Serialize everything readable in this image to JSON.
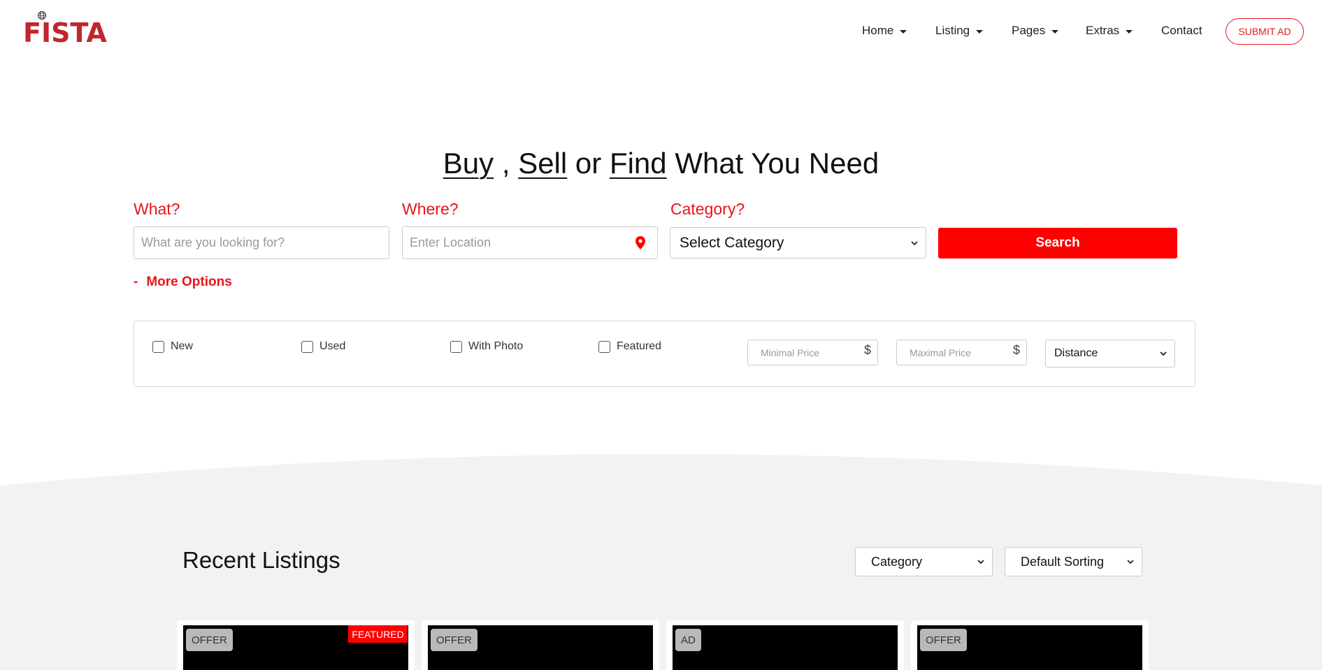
{
  "brand": {
    "logo_text": "FISTA",
    "color": "#c0262d",
    "accent": "#e8151b"
  },
  "nav": {
    "items": [
      {
        "label": "Home",
        "dropdown": true
      },
      {
        "label": "Listing",
        "dropdown": true
      },
      {
        "label": "Pages",
        "dropdown": true
      },
      {
        "label": "Extras",
        "dropdown": true
      },
      {
        "label": "Contact",
        "dropdown": false
      }
    ],
    "submit_label": "SUBMIT AD"
  },
  "hero": {
    "word1": "Buy",
    "sep1": ",",
    "word2": "Sell",
    "sep2": "or",
    "word3": "Find",
    "rest": "What You Need"
  },
  "search": {
    "what_label": "What?",
    "what_placeholder": "What are you looking for?",
    "where_label": "Where?",
    "where_placeholder": "Enter Location",
    "category_label": "Category?",
    "category_selected": "Select Category",
    "button_label": "Search",
    "location_icon": "map-pin-icon"
  },
  "more_options": {
    "symbol": "-",
    "label": "More Options"
  },
  "filters": {
    "checkboxes": [
      "New",
      "Used",
      "With Photo",
      "Featured"
    ],
    "min_price_placeholder": "Minimal Price",
    "max_price_placeholder": "Maximal Price",
    "currency": "$",
    "distance_selected": "Distance"
  },
  "listings": {
    "title": "Recent Listings",
    "category_selected": "Category",
    "sorting_selected": "Default Sorting",
    "cards": [
      {
        "badge": "OFFER",
        "featured": "FEATURED"
      },
      {
        "badge": "OFFER"
      },
      {
        "badge": "AD"
      },
      {
        "badge": "OFFER"
      }
    ]
  }
}
